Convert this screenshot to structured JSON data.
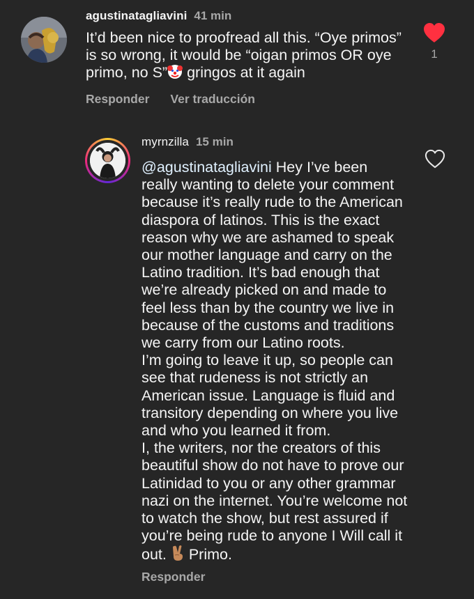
{
  "comments": [
    {
      "username": "agustinatagliavini",
      "time": "41 min",
      "text_lines": [
        "It’d been nice to proofread all this. “Oye primos”",
        "is so wrong, it would be “oigan primos OR oye",
        "primo, no S”",
        " gringos at it again"
      ],
      "emoji_after_line3": "clown-face-emoji",
      "reply_label": "Responder",
      "translate_label": "Ver traducción",
      "likes": "1",
      "liked": true,
      "like_color": "#ff3040"
    },
    {
      "username": "myrnzilla",
      "time": "15 min",
      "mention": "@agustinatagliavini",
      "first_line_rest": " Hey I’ve been",
      "text_lines": [
        "really wanting to delete your comment",
        "because it’s really rude to the American",
        "diaspora of latinos. This is the exact",
        "reason why we are ashamed to speak",
        "our mother language and carry on the",
        "Latino tradition. It’s bad enough that",
        "we’re already picked on and made to",
        "feel less than by the country we live in",
        "because of the customs and traditions",
        "we carry from our Latino roots.",
        "I’m going to leave it up, so people can",
        "see that rudeness is not strictly an",
        "American issue. Language is fluid and",
        "transitory depending on where you live",
        "and who you learned it from.",
        "I, the writers, nor the creators of this",
        "beautiful show do not have to prove our",
        "Latinidad to you or any other grammar",
        "nazi on the internet. You’re welcome not",
        "to watch the show, but rest assured if",
        "you’re being rude to anyone I Will call it"
      ],
      "last_line_start": "out. ",
      "last_line_emoji": "victory-hand-emoji",
      "last_line_end": " Primo.",
      "reply_label": "Responder",
      "liked": false,
      "story_ring_colors": [
        "#f9ce34",
        "#ee2a7b",
        "#6228d7"
      ]
    }
  ]
}
